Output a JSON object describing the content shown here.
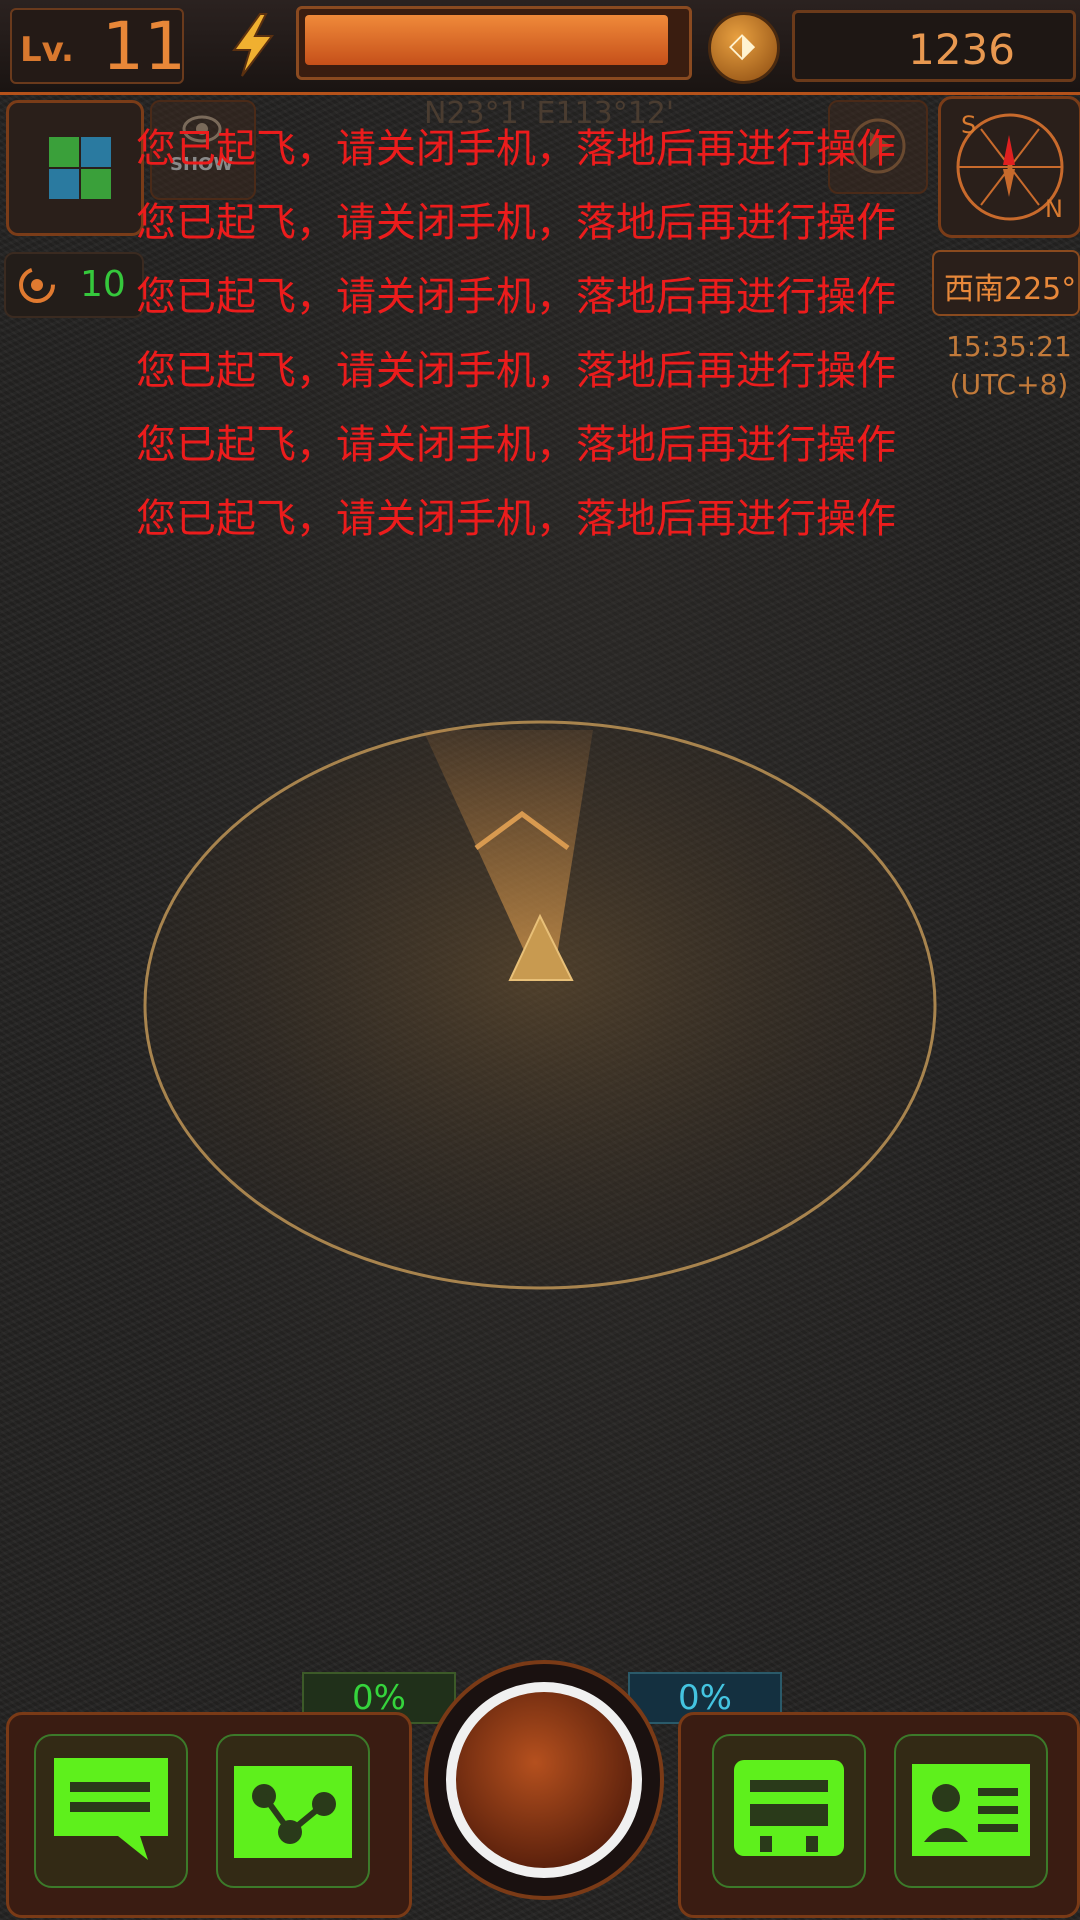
{
  "hud": {
    "level_label": "Lv.",
    "level_value": "11",
    "energy_fraction": 0.96,
    "coins": "1236",
    "coordinates": "N23°1' E113°12'",
    "show_label": "SHOW",
    "boost_count": "10",
    "heading": "西南225°",
    "time": "15:35:21",
    "timezone": "(UTC+8)"
  },
  "compass": {
    "south": "S",
    "north": "N"
  },
  "messages": [
    "您已起飞，请关闭手机，落地后再进行操作",
    "您已起飞，请关闭手机，落地后再进行操作",
    "您已起飞，请关闭手机，落地后再进行操作",
    "您已起飞，请关闭手机，落地后再进行操作",
    "您已起飞，请关闭手机，落地后再进行操作",
    "您已起飞，请关闭手机，落地后再进行操作"
  ],
  "bottom": {
    "left_percent": "0%",
    "right_percent": "0%"
  },
  "colors": {
    "accent": "#e8883a",
    "message_red": "#ec1c1c",
    "button_green": "#5ef01c",
    "cyan": "#44c4e0"
  },
  "icons": [
    "lightning-icon",
    "coin-icon",
    "grid-icon",
    "show-icon",
    "navigate-icon",
    "compass-icon",
    "rotate-icon",
    "chat-icon",
    "route-icon",
    "device-icon",
    "profile-card-icon",
    "globe-icon"
  ]
}
